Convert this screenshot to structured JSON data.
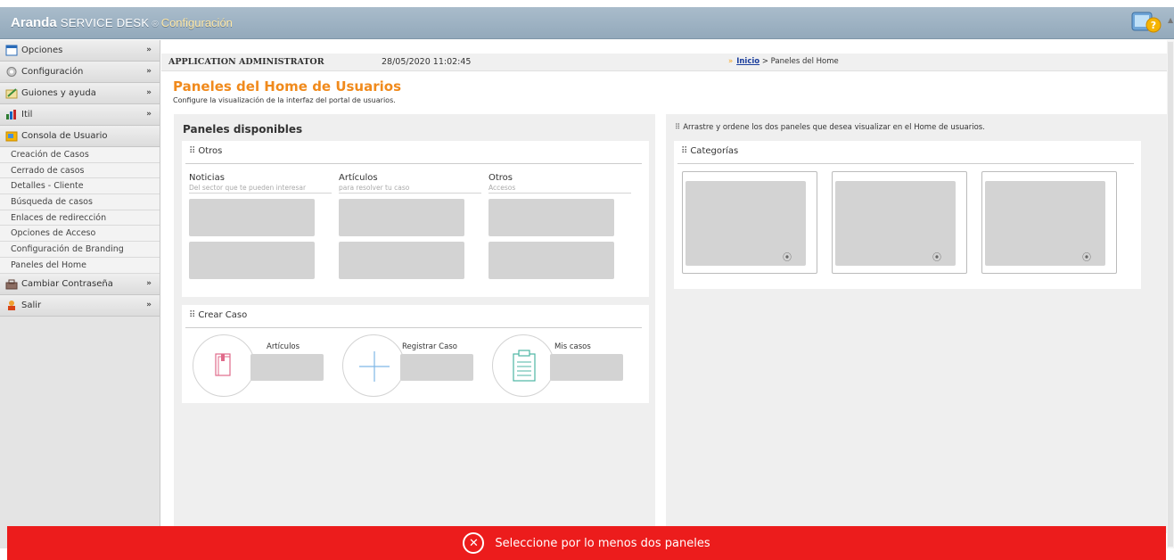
{
  "header": {
    "brand_bold": "Aranda",
    "brand_product": "SERVICE DESK",
    "brand_reg": "®",
    "section": "Configuración"
  },
  "sidebar": {
    "items": [
      {
        "label": "Opciones",
        "icon": "options-icon"
      },
      {
        "label": "Configuración",
        "icon": "gear-icon"
      },
      {
        "label": "Guiones y ayuda",
        "icon": "pencil-icon"
      },
      {
        "label": "Itil",
        "icon": "chart-icon"
      },
      {
        "label": "Consola de Usuario",
        "icon": "folder-icon"
      }
    ],
    "submenu": [
      "Creación de Casos",
      "Cerrado de casos",
      "Detalles - Cliente",
      "Búsqueda de casos",
      "Enlaces de redirección",
      "Opciones de Acceso",
      "Configuración de Branding",
      "Paneles del Home"
    ],
    "bottom_items": [
      {
        "label": "Cambiar Contraseña",
        "icon": "key-icon"
      },
      {
        "label": "Salir",
        "icon": "exit-icon"
      }
    ]
  },
  "infobar": {
    "user": "APPLICATION ADMINISTRATOR",
    "datetime": "28/05/2020 11:02:45",
    "breadcrumb_sep": "»",
    "breadcrumb_home": "Inicio",
    "breadcrumb_current": "> Paneles del Home"
  },
  "page": {
    "title": "Paneles del Home de Usuarios",
    "subtitle": "Configure la visualización de la interfaz del portal de usuarios."
  },
  "left_panel": {
    "title": "Paneles disponibles",
    "otros": {
      "header": "Otros",
      "columns": [
        {
          "title": "Noticias",
          "sub": "Del sector que te pueden interesar"
        },
        {
          "title": "Artículos",
          "sub": "para resolver tu caso"
        },
        {
          "title": "Otros",
          "sub": "Accesos"
        }
      ]
    },
    "crear_caso": {
      "header": "Crear Caso",
      "items": [
        {
          "label": "Artículos",
          "icon": "book-icon"
        },
        {
          "label": "Registrar Caso",
          "icon": "plus-icon"
        },
        {
          "label": "Mis casos",
          "icon": "clipboard-icon"
        }
      ]
    }
  },
  "right_panel": {
    "message": "Arrastre y ordene los dos paneles que desea visualizar en el Home de usuarios.",
    "categorias": {
      "header": "Categorías",
      "cards": 3
    }
  },
  "toast": {
    "message": "Seleccione por lo menos dos paneles",
    "color": "#ec1c1c"
  }
}
